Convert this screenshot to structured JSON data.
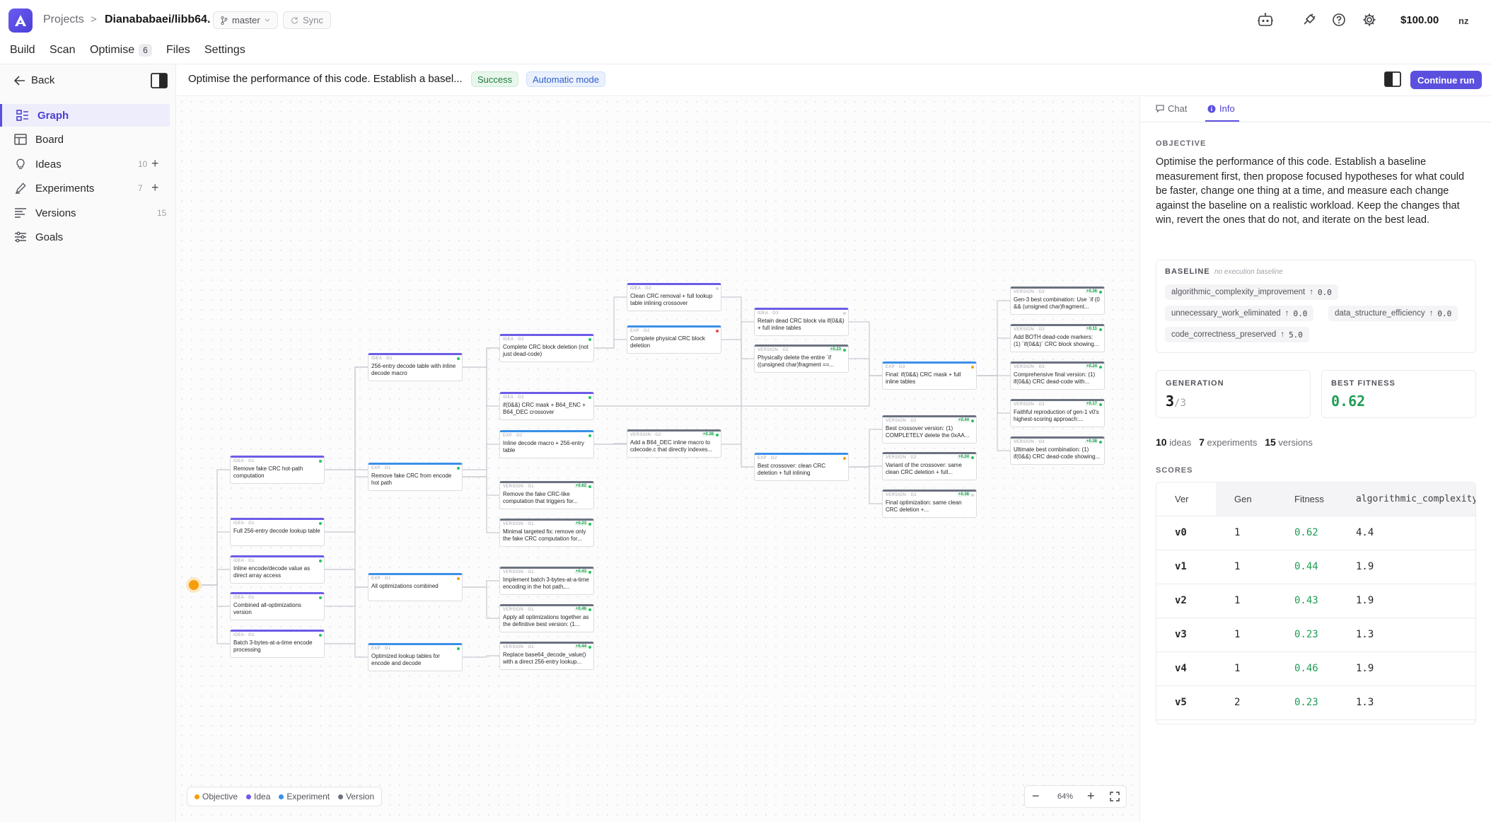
{
  "app": {
    "breadcrumb_projects": "Projects",
    "breadcrumb_separator": ">",
    "repo": "Dianababaei/libb64.",
    "branch": "master",
    "sync_label": "Sync",
    "credits": "$100.00",
    "user_initials": "nz",
    "accent_color": "#5b4fe0"
  },
  "nav": {
    "build": "Build",
    "scan": "Scan",
    "optimise": "Optimise",
    "optimise_badge": "6",
    "files": "Files",
    "settings": "Settings"
  },
  "sidebar": {
    "back": "Back",
    "items": [
      {
        "label": "Graph",
        "icon": "graph-icon"
      },
      {
        "label": "Board",
        "icon": "board-icon"
      },
      {
        "label": "Ideas",
        "icon": "lightbulb-icon",
        "count": "10",
        "plus": "+"
      },
      {
        "label": "Experiments",
        "icon": "flask-icon",
        "count": "7",
        "plus": "+"
      },
      {
        "label": "Versions",
        "icon": "versions-icon",
        "count": "15"
      },
      {
        "label": "Goals",
        "icon": "sliders-icon"
      }
    ]
  },
  "task": {
    "title": "Optimise the performance of this code. Establish a basel...",
    "status": "Success",
    "mode": "Automatic mode",
    "continue_label": "Continue run"
  },
  "graph": {
    "nodes": [
      {
        "id": "n1",
        "kind": "IDEA · G1",
        "type": "idea",
        "text": "Remove fake CRC hot-path computation",
        "dot": "green"
      },
      {
        "id": "n2",
        "kind": "IDEA · G1",
        "type": "idea",
        "text": "Full 256-entry decode lookup table",
        "dot": "green"
      },
      {
        "id": "n3",
        "kind": "IDEA · G1",
        "type": "idea",
        "text": "Inline encode/decode value as direct array access",
        "dot": "green"
      },
      {
        "id": "n4",
        "kind": "IDEA · G1",
        "type": "idea",
        "text": "Combined all-optimizations version",
        "dot": "green"
      },
      {
        "id": "n5",
        "kind": "IDEA · G1",
        "type": "idea",
        "text": "Batch 3-bytes-at-a-time encode processing",
        "dot": "green"
      },
      {
        "id": "n6",
        "kind": "IDEA · G1",
        "type": "idea",
        "text": "256-entry decode table with inline decode macro",
        "dot": "green"
      },
      {
        "id": "n7",
        "kind": "EXP · G1",
        "type": "exp",
        "text": "Remove fake CRC from encode hot path",
        "dot": "green"
      },
      {
        "id": "n8",
        "kind": "EXP · G1",
        "type": "exp",
        "text": "All optimizations combined",
        "dot": "orange"
      },
      {
        "id": "n9",
        "kind": "EXP · G1",
        "type": "exp",
        "text": "Optimized lookup tables for encode and decode",
        "dot": "green"
      },
      {
        "id": "n10",
        "kind": "IDEA · G2",
        "type": "idea",
        "text": "Complete CRC block deletion (not just dead-code)",
        "dot": "green"
      },
      {
        "id": "n11",
        "kind": "IDEA · G2",
        "type": "idea",
        "text": "if(0&&) CRC mask + B64_ENC + B64_DEC crossover",
        "dot": "green"
      },
      {
        "id": "n12",
        "kind": "EXP · G2",
        "type": "exp",
        "text": "Inline decode macro + 256-entry table",
        "dot": "green"
      },
      {
        "id": "n13",
        "kind": "VERSION · G1",
        "type": "ver",
        "score": "+0.62",
        "text": "Remove the fake CRC-like computation that triggers for...",
        "dot": "green"
      },
      {
        "id": "n14",
        "kind": "VERSION · G1",
        "type": "ver",
        "score": "+0.23",
        "text": "Minimal targeted fix: remove only the fake CRC computation for...",
        "dot": "green"
      },
      {
        "id": "n15",
        "kind": "VERSION · G1",
        "type": "ver",
        "score": "+0.43",
        "text": "Implement batch 3-bytes-at-a-time encoding in the hot path,...",
        "dot": "green"
      },
      {
        "id": "n16",
        "kind": "VERSION · G1",
        "type": "ver",
        "score": "+0.46",
        "text": "Apply all optimizations together as the definitive best version: (1...",
        "dot": "green"
      },
      {
        "id": "n17",
        "kind": "VERSION · G1",
        "type": "ver",
        "score": "+0.44",
        "text": "Replace base64_decode_value() with a direct 256-entry lookup...",
        "dot": "green"
      },
      {
        "id": "n18",
        "kind": "IDEA · G2",
        "type": "idea",
        "text": "Clean CRC removal + full lookup table inlining crossover",
        "dot": "grey"
      },
      {
        "id": "n19",
        "kind": "EXP · G2",
        "type": "exp",
        "text": "Complete physical CRC block deletion",
        "dot": "red"
      },
      {
        "id": "n20",
        "kind": "VERSION · G2",
        "type": "ver",
        "score": "+0.38",
        "text": "Add a B64_DEC inline macro to cdecode.c that directly indexes...",
        "dot": "green"
      },
      {
        "id": "n21",
        "kind": "IDEA · G3",
        "type": "idea",
        "text": "Retain dead CRC block via if(0&&) + full inline tables",
        "dot": "grey"
      },
      {
        "id": "n22",
        "kind": "VERSION · G2",
        "type": "ver",
        "score": "+0.23",
        "text": "Physically delete the entire `if ((unsigned char)fragment ==...",
        "dot": "green"
      },
      {
        "id": "n23",
        "kind": "EXP · G2",
        "type": "exp",
        "text": "Best crossover: clean CRC deletion + full inlining",
        "dot": "orange"
      },
      {
        "id": "n24",
        "kind": "EXP · G3",
        "type": "exp",
        "text": "Final: if(0&&) CRC mask + full inline tables",
        "dot": "orange"
      },
      {
        "id": "n25",
        "kind": "VERSION · G2",
        "type": "ver",
        "score": "+0.44",
        "text": "Best crossover version: (1) COMPLETELY delete the 0xAA...",
        "dot": "green"
      },
      {
        "id": "n26",
        "kind": "VERSION · G2",
        "type": "ver",
        "score": "+0.24",
        "text": "Variant of the crossover: same clean CRC deletion + full...",
        "dot": "green"
      },
      {
        "id": "n27",
        "kind": "VERSION · G2",
        "type": "ver",
        "score": "+0.38",
        "text": "Final optimization: same clean CRC deletion +...",
        "dot": "grey"
      },
      {
        "id": "n28",
        "kind": "VERSION · G3",
        "type": "ver",
        "score": "+0.36",
        "text": "Gen-3 best combination: Use `if (0 && (unsigned char)fragment...",
        "dot": "green"
      },
      {
        "id": "n29",
        "kind": "VERSION · G3",
        "type": "ver",
        "score": "+0.11",
        "text": "Add BOTH dead-code markers: (1) `if(0&&)` CRC block showing...",
        "dot": "green"
      },
      {
        "id": "n30",
        "kind": "VERSION · G3",
        "type": "ver",
        "score": "+0.24",
        "text": "Comprehensive final version: (1) if(0&&) CRC dead-code with...",
        "dot": "green"
      },
      {
        "id": "n31",
        "kind": "VERSION · G3",
        "type": "ver",
        "score": "+0.17",
        "text": "Faithful reproduction of gen-1 v0's highest-scoring approach:...",
        "dot": "green"
      },
      {
        "id": "n32",
        "kind": "VERSION · G3",
        "type": "ver",
        "score": "+0.38",
        "text": "Ultimate best combination: (1) if(0&&) CRC dead-code showing...",
        "dot": "green"
      }
    ],
    "legend": {
      "objective": "Objective",
      "idea": "Idea",
      "experiment": "Experiment",
      "version": "Version",
      "objective_color": "#f59e0b",
      "idea_color": "#6c5ce7",
      "experiment_color": "#3b8fe8",
      "version_color": "#6b7280"
    },
    "zoom": "64%",
    "zoom_out": "−",
    "zoom_in": "+"
  },
  "panel": {
    "tabs": {
      "chat": "Chat",
      "info": "Info"
    },
    "objective_label": "OBJECTIVE",
    "objective": "Optimise the performance of this code. Establish a baseline measurement first, then propose focused hypotheses for what could be faster, change one thing at a time, and measure each change against the baseline on a realistic workload. Keep the changes that win, revert the ones that do not, and iterate on the best lead.",
    "baseline_label": "BASELINE",
    "baseline_note": "no execution baseline",
    "baseline_metrics": [
      {
        "name": "algorithmic_complexity_improvement",
        "arrow": "↑",
        "value": "0.0"
      },
      {
        "name": "unnecessary_work_eliminated",
        "arrow": "↑",
        "value": "0.0"
      },
      {
        "name": "data_structure_efficiency",
        "arrow": "↑",
        "value": "0.0"
      },
      {
        "name": "code_correctness_preserved",
        "arrow": "↑",
        "value": "5.0"
      }
    ],
    "generation_label": "GENERATION",
    "generation": "3",
    "generation_total": "/3",
    "best_fitness_label": "BEST FITNESS",
    "best_fitness": "0.62",
    "counts": {
      "ideas_n": "10",
      "ideas": "ideas",
      "experiments_n": "7",
      "experiments": "experiments",
      "versions_n": "15",
      "versions": "versions"
    },
    "scores_label": "SCORES",
    "scores_headers": [
      "Ver",
      "Gen",
      "Fitness",
      "algorithmic_complexity_"
    ],
    "scores": [
      {
        "ver": "v0",
        "gen": "1",
        "fitness": "0.62",
        "alg": "4.4"
      },
      {
        "ver": "v1",
        "gen": "1",
        "fitness": "0.44",
        "alg": "1.9"
      },
      {
        "ver": "v2",
        "gen": "1",
        "fitness": "0.43",
        "alg": "1.9"
      },
      {
        "ver": "v3",
        "gen": "1",
        "fitness": "0.23",
        "alg": "1.3"
      },
      {
        "ver": "v4",
        "gen": "1",
        "fitness": "0.46",
        "alg": "1.9"
      },
      {
        "ver": "v5",
        "gen": "2",
        "fitness": "0.23",
        "alg": "1.3"
      }
    ]
  }
}
